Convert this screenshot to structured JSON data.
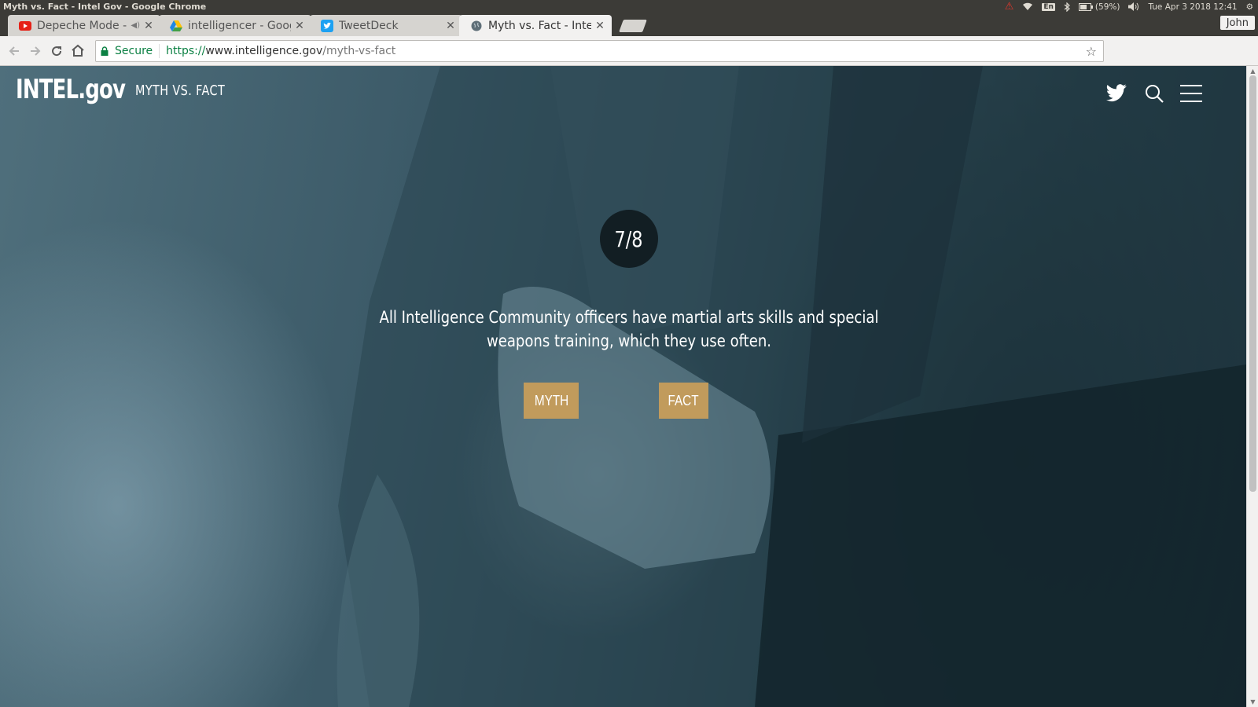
{
  "os_panel": {
    "window_title": "Myth vs. Fact - Intel Gov - Google Chrome",
    "keyboard": "En",
    "battery": "(59%)",
    "datetime": "Tue Apr  3 2018 12:41"
  },
  "browser": {
    "tabs": [
      {
        "label": "Depeche Mode - I",
        "icon": "youtube-icon"
      },
      {
        "label": "intelligencer - Goog",
        "icon": "google-drive-icon"
      },
      {
        "label": "TweetDeck",
        "icon": "twitter-icon"
      },
      {
        "label": "Myth vs. Fact - Intel",
        "icon": "globe-icon",
        "active": true
      }
    ],
    "user": "John",
    "secure_label": "Secure",
    "url_scheme": "https://",
    "url_host": "www.intelligence.gov",
    "url_path": "/myth-vs-fact"
  },
  "site": {
    "logo": "INTEL.gov",
    "section_title": "MYTH VS. FACT",
    "counter": "7/8",
    "statement": "All Intelligence Community officers have martial arts skills and special weapons training, which they use often.",
    "myth_label": "MYTH",
    "fact_label": "FACT"
  },
  "colors": {
    "accent_gold": "#c19b5c",
    "secure_green": "#0b8043"
  }
}
